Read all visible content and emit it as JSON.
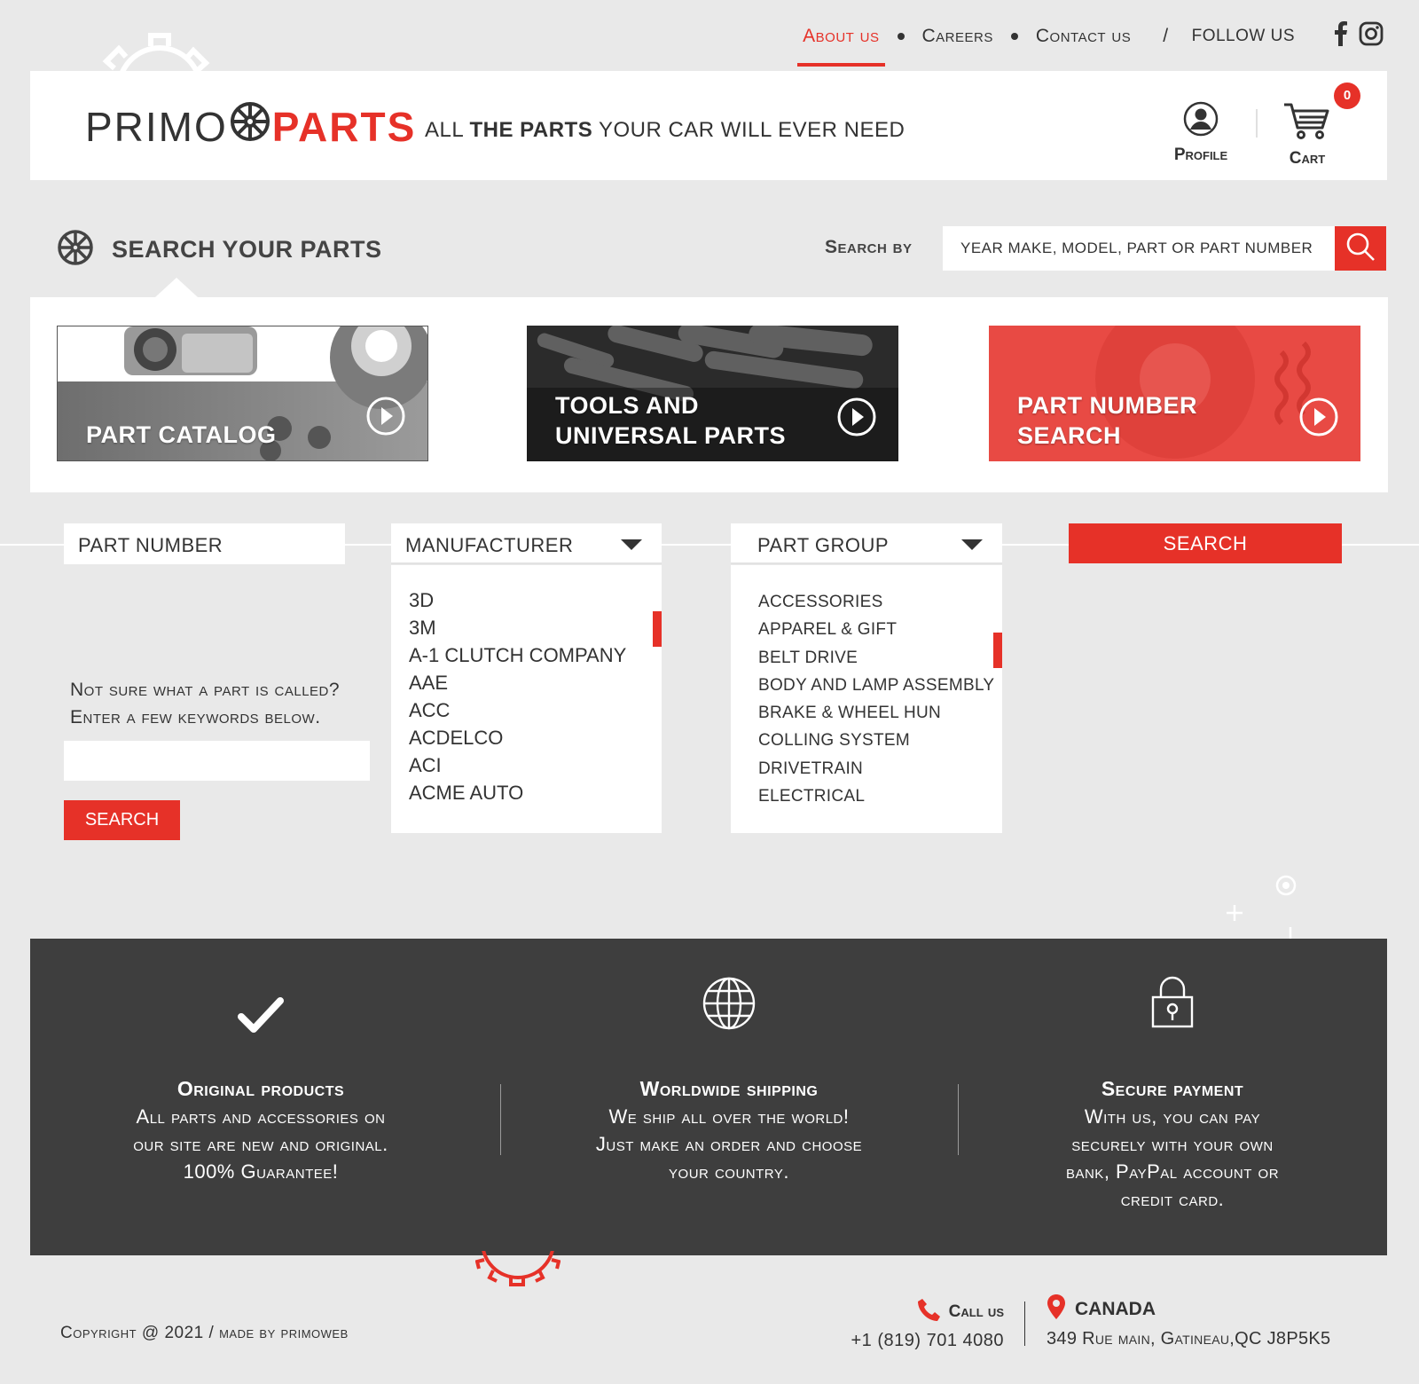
{
  "colors": {
    "accent": "#e63128",
    "dark_band": "#3e3e3e",
    "background": "#e9e9e9"
  },
  "topnav": {
    "items": [
      {
        "label": "About us",
        "active": true
      },
      {
        "label": "Careers"
      },
      {
        "label": "Contact us"
      }
    ],
    "separator": "/",
    "follow_label": "FOLLOW US",
    "social": [
      "facebook-icon",
      "instagram-icon"
    ]
  },
  "header": {
    "logo_left": "PRIMO",
    "logo_right": "PARTS",
    "tagline_1": "ALL ",
    "tagline_2": "THE PARTS",
    "tagline_3": " YOUR CAR  WILL EVER NEED",
    "profile_label": "Profile",
    "cart_label": "Cart",
    "cart_count": "0"
  },
  "search": {
    "title": "SEARCH YOUR PARTS",
    "by_label": "Search by",
    "placeholder": "YEAR MAKE, MODEL, PART OR PART NUMBER"
  },
  "categories": [
    {
      "line1": "PART  CATALOG",
      "line2": ""
    },
    {
      "line1": "TOOLS AND",
      "line2": "UNIVERSAL PARTS"
    },
    {
      "line1": "PART NUMBER",
      "line2": "SEARCH"
    }
  ],
  "filters": {
    "part_number_label": "PART NUMBER",
    "manufacturer_label": "MANUFACTURER",
    "part_group_label": "PART GROUP",
    "search_label": "SEARCH",
    "manufacturers": [
      "3D",
      "3M",
      "A-1 CLUTCH COMPANY",
      "AAE",
      "ACC",
      "ACDELCO",
      "ACI",
      "ACME AUTO"
    ],
    "part_groups": [
      "ACCESSORIES",
      "APPAREL & GIFT",
      "BELT DRIVE",
      "BODY AND LAMP ASSEMBLY",
      "BRAKE & WHEEL HUN",
      "COLLING SYSTEM",
      "DRIVETRAIN",
      "ELECTRICAL"
    ]
  },
  "keyword": {
    "line1": "Not sure what a part is called?",
    "line2": "Enter a few keywords below.",
    "button": "SEARCH"
  },
  "features": [
    {
      "icon": "checkmark-icon",
      "title": "Original products",
      "lines": [
        "All parts and accessories on",
        "our site are new and original.",
        "100% Guarantee!"
      ]
    },
    {
      "icon": "globe-icon",
      "title": "Worldwide shipping",
      "lines": [
        "We ship all over the world!",
        "Just make an order and choose",
        "your country."
      ]
    },
    {
      "icon": "lock-icon",
      "title": "Secure payment",
      "lines": [
        "With us, you can pay",
        "securely with your own",
        "bank, PayPal account or",
        "credit card."
      ]
    }
  ],
  "footer": {
    "copyright": "Copyright @ 2021 /  made by primoweb",
    "call_label": "Call us",
    "phone": "+1 (819) 701 4080",
    "country": "CANADA",
    "address": "349 Rue main, Gatineau,QC J8P5K5"
  }
}
